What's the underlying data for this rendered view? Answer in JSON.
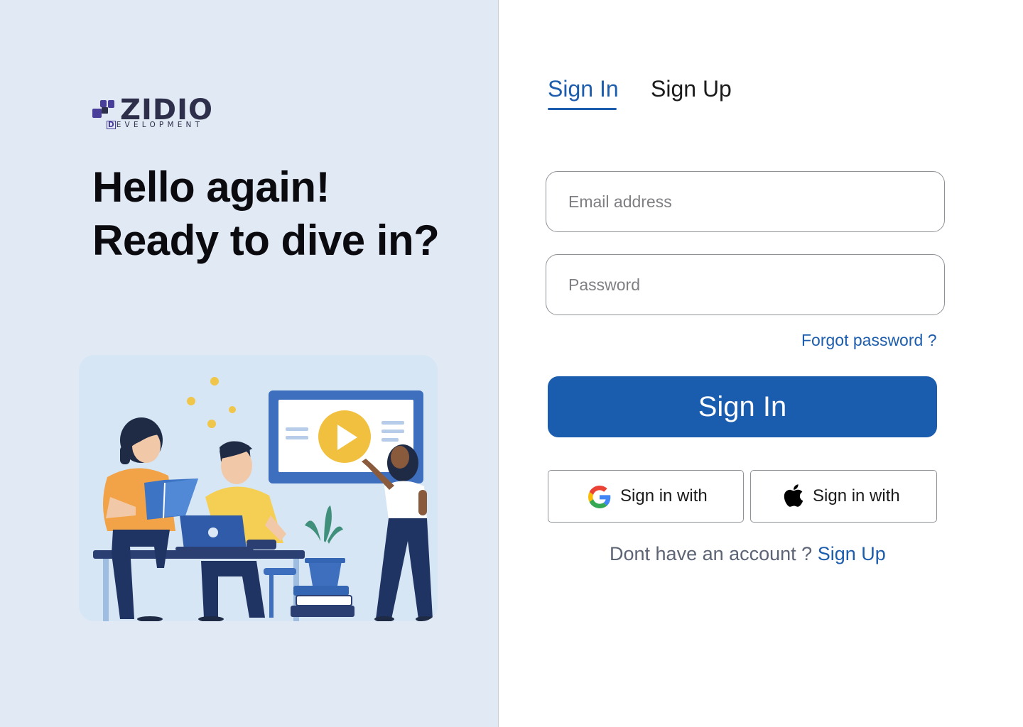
{
  "brand": {
    "name": "ZIDIO",
    "tagline_first_letter": "D",
    "tagline_rest": "EVELOPMENT",
    "mark_colors": [
      "#4a3e9b",
      "#2e2f4a"
    ]
  },
  "hero": {
    "line1": "Hello again!",
    "line2": "Ready to dive in?"
  },
  "illustration": {
    "icon": "people-learning-illustration"
  },
  "tabs": [
    {
      "label": "Sign In",
      "active": true
    },
    {
      "label": "Sign Up",
      "active": false
    }
  ],
  "form": {
    "email": {
      "placeholder": "Email address",
      "value": ""
    },
    "password": {
      "placeholder": "Password",
      "value": ""
    },
    "forgot_label": "Forgot password ?",
    "submit_label": "Sign In"
  },
  "social": {
    "google": {
      "label": "Sign in with",
      "icon": "google-icon"
    },
    "apple": {
      "label": "Sign in with",
      "icon": "apple-icon"
    }
  },
  "footer": {
    "question": "Dont have an account ?",
    "link": "Sign Up"
  },
  "colors": {
    "accent": "#1d5dad",
    "primary_button": "#1a5cae",
    "left_panel_bg": "#e1e9f4"
  }
}
